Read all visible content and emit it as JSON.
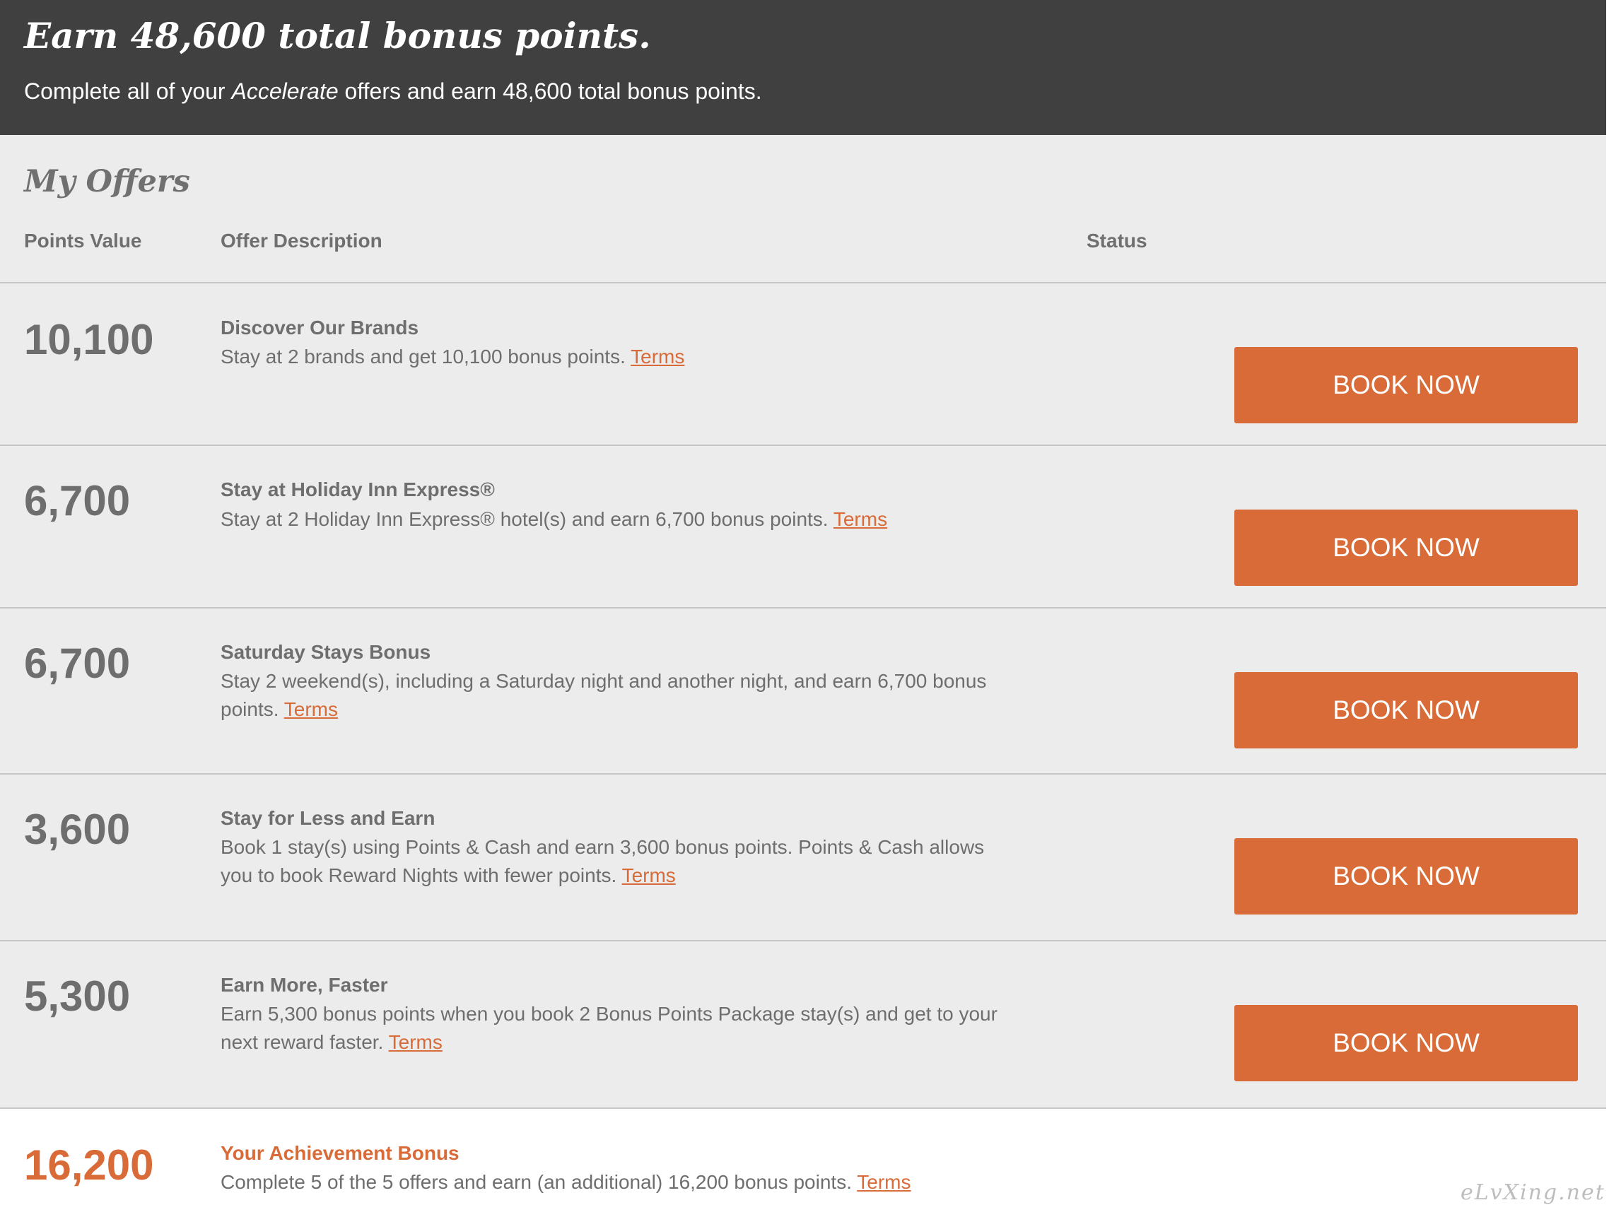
{
  "header": {
    "title": "Earn 48,600 total bonus points.",
    "subtitle_pre": "Complete all of your ",
    "subtitle_em": "Accelerate",
    "subtitle_post": " offers and earn 48,600 total bonus points."
  },
  "offers_section": {
    "title": "My Offers",
    "columns": {
      "points": "Points Value",
      "description": "Offer Description",
      "status": "Status"
    },
    "offers": [
      {
        "points": "10,100",
        "title": "Discover Our Brands",
        "description": "Stay at 2 brands and get 10,100 bonus points.",
        "terms_label": "Terms",
        "button_label": "BOOK NOW"
      },
      {
        "points": "6,700",
        "title": "Stay at Holiday Inn Express®",
        "description": "Stay at 2 Holiday Inn Express® hotel(s) and earn 6,700 bonus points.",
        "terms_label": "Terms",
        "button_label": "BOOK NOW"
      },
      {
        "points": "6,700",
        "title": "Saturday Stays Bonus",
        "description": "Stay 2 weekend(s), including a Saturday night and another night, and earn 6,700 bonus points.",
        "terms_label": "Terms",
        "button_label": "BOOK NOW"
      },
      {
        "points": "3,600",
        "title": "Stay for Less and Earn",
        "description": "Book 1 stay(s) using Points & Cash and earn 3,600 bonus points. Points & Cash allows you to book Reward Nights with fewer points.",
        "terms_label": "Terms",
        "button_label": "BOOK NOW"
      },
      {
        "points": "5,300",
        "title": "Earn More, Faster",
        "description": "Earn 5,300 bonus points when you book 2 Bonus Points Package stay(s) and get to your next reward faster.",
        "terms_label": "Terms",
        "button_label": "BOOK NOW"
      }
    ]
  },
  "achievement": {
    "points": "16,200",
    "title": "Your Achievement Bonus",
    "description": "Complete 5 of the 5 offers and earn (an additional) 16,200 bonus points.",
    "terms_label": "Terms"
  },
  "watermark": "eLvXing.net",
  "colors": {
    "header_bg": "#404040",
    "section_bg": "#ececec",
    "accent": "#d86b37",
    "text_gray": "#6e6e6e"
  }
}
